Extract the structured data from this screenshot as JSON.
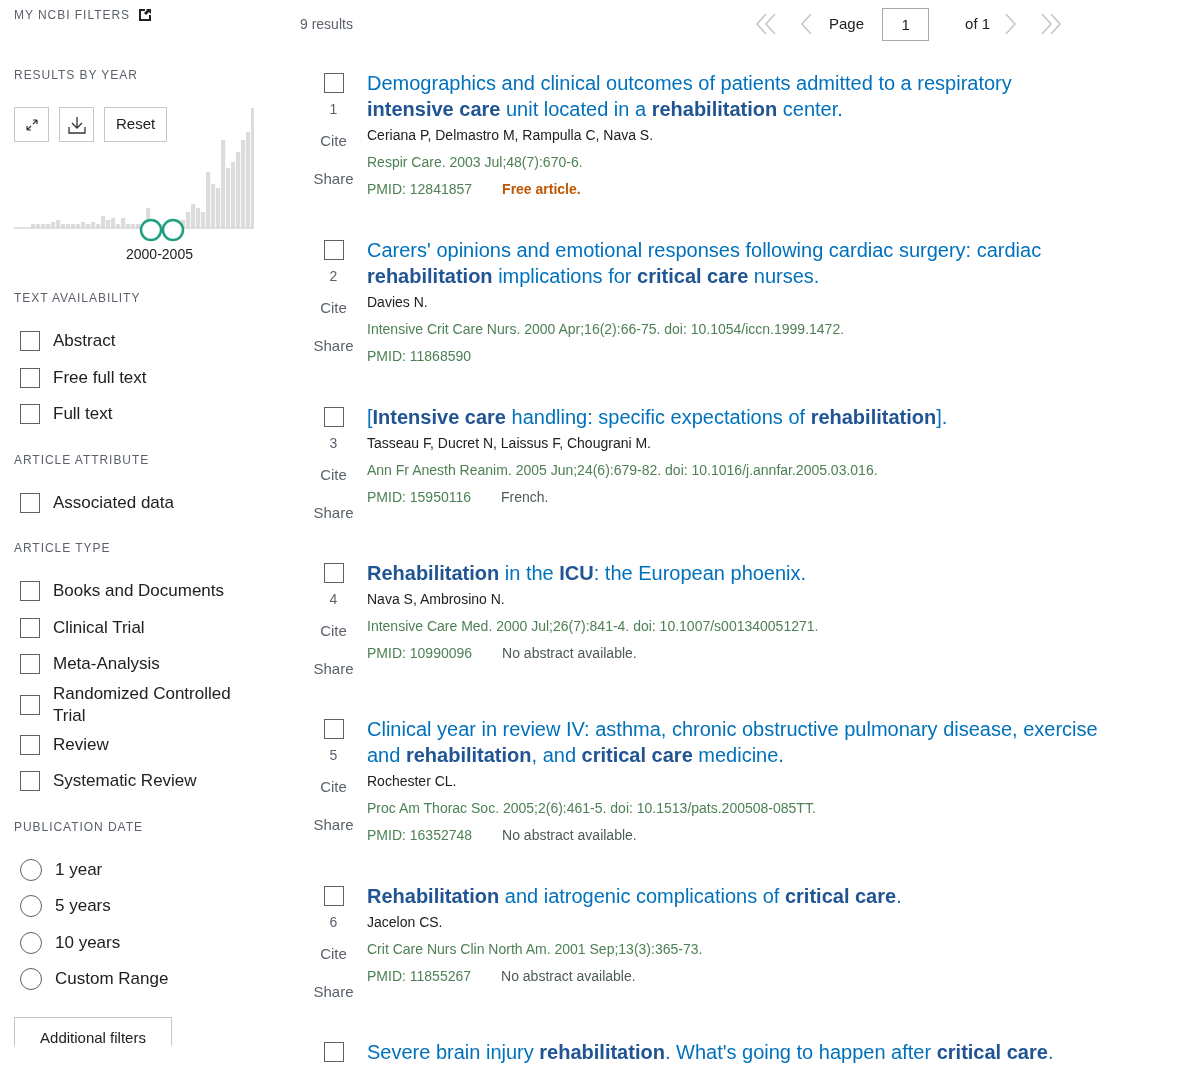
{
  "sidebar": {
    "my_filters": {
      "title": "MY NCBI FILTERS"
    },
    "results_by_year": {
      "title": "RESULTS BY YEAR",
      "reset_button": "Reset",
      "range_label": "2000-2005"
    },
    "sections": [
      {
        "title": "TEXT AVAILABILITY",
        "items": [
          {
            "kind": "checkbox",
            "label": "Abstract",
            "checked": false
          },
          {
            "kind": "checkbox",
            "label": "Free full text",
            "checked": false
          },
          {
            "kind": "checkbox",
            "label": "Full text",
            "checked": false
          }
        ]
      },
      {
        "title": "ARTICLE ATTRIBUTE",
        "items": [
          {
            "kind": "checkbox",
            "label": "Associated data",
            "checked": false
          }
        ]
      },
      {
        "title": "ARTICLE TYPE",
        "items": [
          {
            "kind": "checkbox",
            "label": "Books and Documents",
            "checked": false
          },
          {
            "kind": "checkbox",
            "label": "Clinical Trial",
            "checked": false
          },
          {
            "kind": "checkbox",
            "label": "Meta-Analysis",
            "checked": false
          },
          {
            "kind": "checkbox",
            "label": "Randomized Controlled Trial",
            "checked": false
          },
          {
            "kind": "checkbox",
            "label": "Review",
            "checked": false
          },
          {
            "kind": "checkbox",
            "label": "Systematic Review",
            "checked": false
          }
        ]
      },
      {
        "title": "PUBLICATION DATE",
        "items": [
          {
            "kind": "radio",
            "label": "1 year",
            "selected": false
          },
          {
            "kind": "radio",
            "label": "5 years",
            "selected": false
          },
          {
            "kind": "radio",
            "label": "10 years",
            "selected": false
          },
          {
            "kind": "radio",
            "label": "Custom Range",
            "selected": false
          }
        ]
      }
    ],
    "additional_filters_button": "Additional filters"
  },
  "results_header": {
    "count": "9 results",
    "page_label": "Page",
    "page_value": "1",
    "page_total": "of 1"
  },
  "results": [
    {
      "checked": false,
      "number": "1",
      "cite": "Cite",
      "share": "Share",
      "title": "Demographics and clinical outcomes of patients admitted to a respiratory **intensive care** unit located in a **rehabilitation** center.",
      "authors": "Ceriana P, Delmastro M, Rampulla C, Nava S.",
      "citation": "Respir Care. 2003 Jul;48(7):670-6.",
      "pmid": "PMID: 12841857",
      "note": {
        "kind": "free",
        "text": "Free article."
      }
    },
    {
      "checked": false,
      "number": "2",
      "cite": "Cite",
      "share": "Share",
      "title": "Carers' opinions and emotional responses following cardiac surgery: cardiac **rehabilitation** implications for **critical care** nurses.",
      "authors": "Davies N.",
      "citation": "Intensive Crit Care Nurs. 2000 Apr;16(2):66-75. doi: 10.1054/iccn.1999.1472.",
      "pmid": "PMID: 11868590"
    },
    {
      "checked": false,
      "number": "3",
      "cite": "Cite",
      "share": "Share",
      "title": "[**Intensive care** handling: specific expectations of **rehabilitation**].",
      "authors": "Tasseau F, Ducret N, Laissus F, Chougrani M.",
      "citation": "Ann Fr Anesth Reanim. 2005 Jun;24(6):679-82. doi: 10.1016/j.annfar.2005.03.016.",
      "pmid": "PMID: 15950116",
      "note": {
        "kind": "plain",
        "text": "French."
      }
    },
    {
      "checked": false,
      "number": "4",
      "cite": "Cite",
      "share": "Share",
      "title": "**Rehabilitation** in the **ICU**: the European phoenix.",
      "authors": "Nava S, Ambrosino N.",
      "citation": "Intensive Care Med. 2000 Jul;26(7):841-4. doi: 10.1007/s001340051271.",
      "pmid": "PMID: 10990096",
      "note": {
        "kind": "plain",
        "text": "No abstract available."
      }
    },
    {
      "checked": false,
      "number": "5",
      "cite": "Cite",
      "share": "Share",
      "title": "Clinical year in review IV: asthma, chronic obstructive pulmonary disease, exercise and **rehabilitation**, and **critical care** medicine.",
      "authors": "Rochester CL.",
      "citation": "Proc Am Thorac Soc. 2005;2(6):461-5. doi: 10.1513/pats.200508-085TT.",
      "pmid": "PMID: 16352748",
      "note": {
        "kind": "plain",
        "text": "No abstract available."
      }
    },
    {
      "checked": false,
      "number": "6",
      "cite": "Cite",
      "share": "Share",
      "title": "**Rehabilitation** and iatrogenic complications of **critical care**.",
      "authors": "Jacelon CS.",
      "citation": "Crit Care Nurs Clin North Am. 2001 Sep;13(3):365-73.",
      "pmid": "PMID: 11855267",
      "note": {
        "kind": "plain",
        "text": "No abstract available."
      }
    },
    {
      "checked": false,
      "title": "Severe brain injury **rehabilitation**. What's going to happen after **critical care**."
    }
  ]
}
